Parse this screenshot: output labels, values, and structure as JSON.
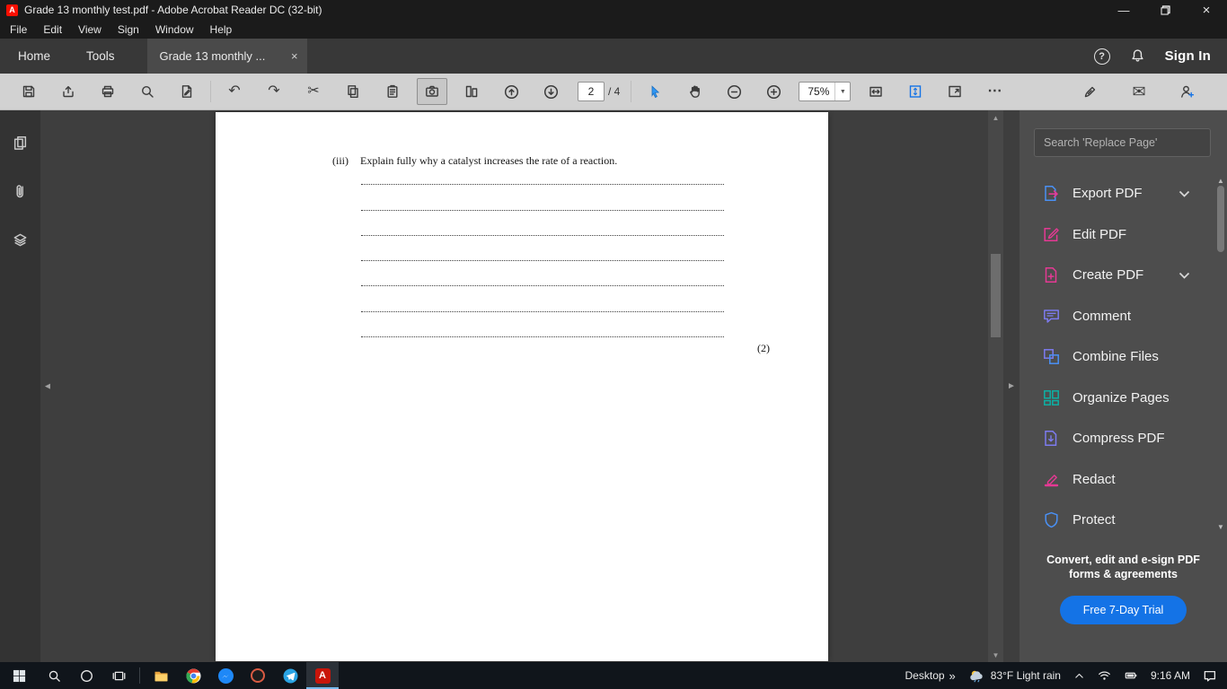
{
  "window": {
    "title": "Grade 13 monthly test.pdf - Adobe Acrobat Reader DC (32-bit)"
  },
  "menu": {
    "items": [
      "File",
      "Edit",
      "View",
      "Sign",
      "Window",
      "Help"
    ]
  },
  "tab_bar": {
    "home": "Home",
    "tools": "Tools",
    "document_tab": "Grade 13 monthly ...",
    "sign_in": "Sign In"
  },
  "toolbar": {
    "page_number": "2",
    "page_total": "/ 4",
    "zoom_level": "75%"
  },
  "document": {
    "question_number": "(iii)",
    "question_text": "Explain fully why a catalyst increases the rate of a reaction.",
    "marks": "(2)",
    "answer_line_count": 7
  },
  "right_panel": {
    "search_placeholder": "Search 'Replace Page'",
    "tools": [
      {
        "label": "Export PDF",
        "icon": "export-pdf-icon",
        "has_chevron": true
      },
      {
        "label": "Edit PDF",
        "icon": "edit-pdf-icon",
        "has_chevron": false
      },
      {
        "label": "Create PDF",
        "icon": "create-pdf-icon",
        "has_chevron": true
      },
      {
        "label": "Comment",
        "icon": "comment-icon",
        "has_chevron": false
      },
      {
        "label": "Combine Files",
        "icon": "combine-files-icon",
        "has_chevron": false
      },
      {
        "label": "Organize Pages",
        "icon": "organize-pages-icon",
        "has_chevron": false
      },
      {
        "label": "Compress PDF",
        "icon": "compress-pdf-icon",
        "has_chevron": false
      },
      {
        "label": "Redact",
        "icon": "redact-icon",
        "has_chevron": false
      },
      {
        "label": "Protect",
        "icon": "protect-icon",
        "has_chevron": false
      }
    ],
    "promo": {
      "line1": "Convert, edit and e-sign PDF",
      "line2": "forms & agreements",
      "button_label": "Free 7-Day Trial"
    }
  },
  "taskbar": {
    "desktop_label": "Desktop",
    "weather": "83°F Light rain",
    "time": "9:16 AM"
  },
  "glyphs": {
    "minimize": "—",
    "close": "×",
    "undo": "↶",
    "redo": "↷",
    "cut": "✂",
    "more": "⋯",
    "envelope": "✉",
    "caret_down": "▼",
    "arrow_up": "▲",
    "arrow_down": "▼",
    "collapse_left": "◄",
    "collapse_right": "►",
    "chevrons_right": "»",
    "help": "?"
  },
  "colors": {
    "accent_blue": "#1473e6",
    "adobe_red": "#fa0f00"
  }
}
